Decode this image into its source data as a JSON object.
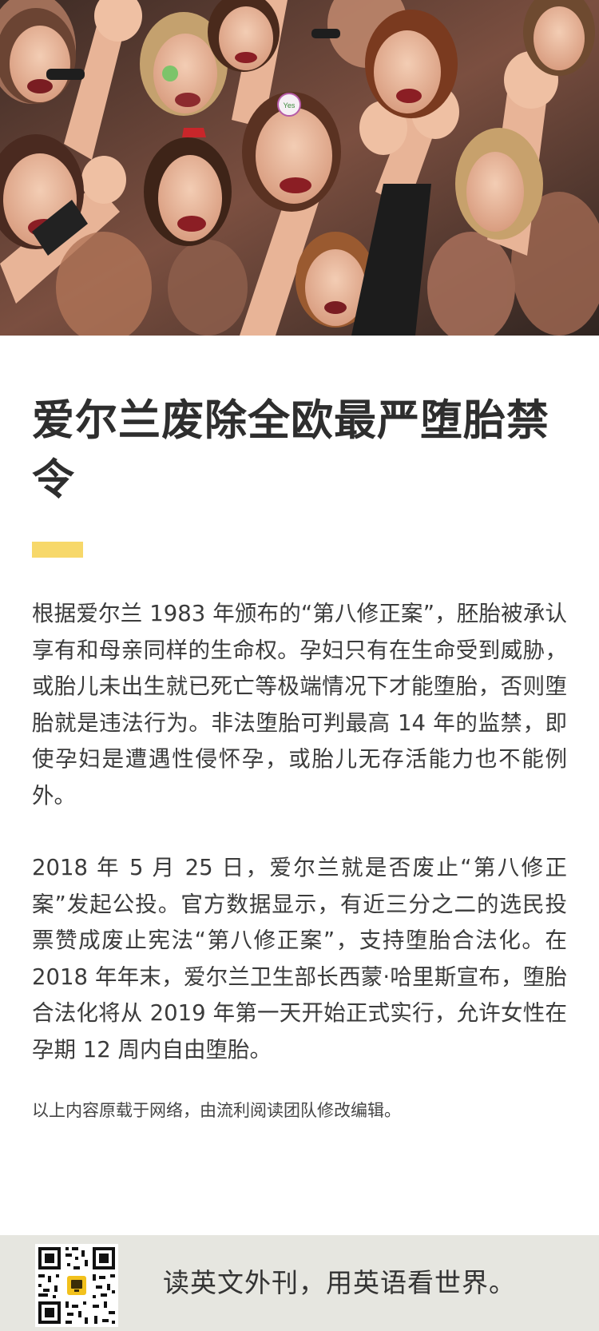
{
  "hero_image": {
    "alt": "",
    "badge_text": "Yes"
  },
  "article": {
    "title": "爱尔兰废除全欧最严堕胎禁令",
    "accent_color": "#f7d86a",
    "paragraphs": [
      "根据爱尔兰 1983 年颁布的“第八修正案”，胚胎被承认享有和母亲同样的生命权。孕妇只有在生命受到威胁，或胎儿未出生就已死亡等极端情况下才能堕胎，否则堕胎就是违法行为。非法堕胎可判最高 14 年的监禁，即使孕妇是遭遇性侵怀孕，或胎儿无存活能力也不能例外。",
      "2018 年 5 月 25 日，爱尔兰就是否废止“第八修正案”发起公投。官方数据显示，有近三分之二的选民投票赞成废止宪法“第八修正案”，支持堕胎合法化。在 2018 年年末，爱尔兰卫生部长西蒙·哈里斯宣布，堕胎合法化将从 2019 年第一天开始正式实行，允许女性在孕期 12 周内自由堕胎。"
    ],
    "source_note": "以上内容原载于网络，由流利阅读团队修改编辑。"
  },
  "footer": {
    "qr_icon": "qr-code-icon",
    "slogan": "读英文外刊，用英语看世界。",
    "background": "#e6e6e0"
  }
}
